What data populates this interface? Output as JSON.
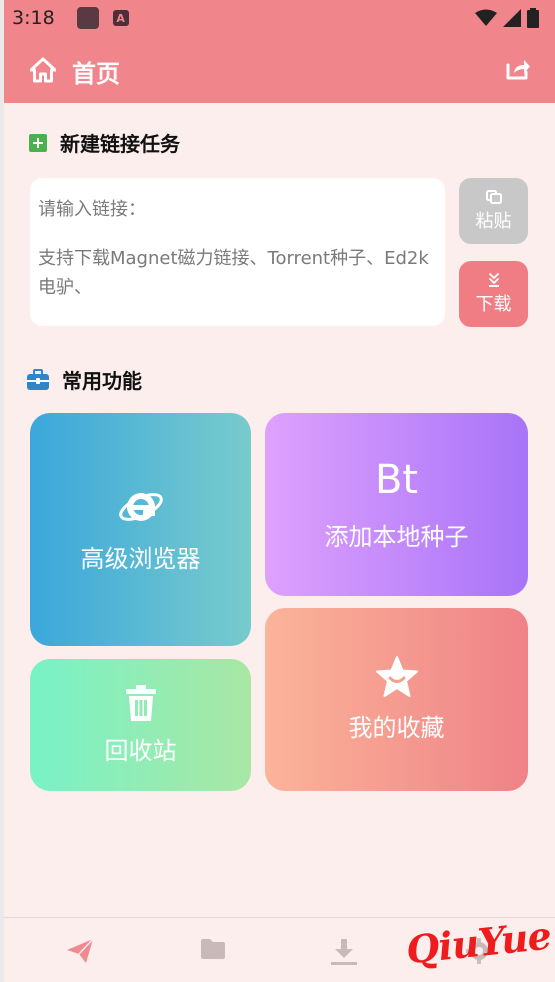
{
  "status_bar": {
    "time": "3:18",
    "app_icon_letter": "A"
  },
  "header": {
    "title": "首页"
  },
  "new_task": {
    "title": "新建链接任务",
    "placeholder": "请输入链接：",
    "hint": "支持下载Magnet磁力链接、Torrent种子、Ed2k电驴、",
    "paste_label": "粘贴",
    "download_label": "下载"
  },
  "features": {
    "title": "常用功能",
    "browser_label": "高级浏览器",
    "bt_logo": "Bt",
    "bt_label": "添加本地种子",
    "trash_label": "回收站",
    "favorites_label": "我的收藏"
  },
  "watermark": "QiuYue",
  "colors": {
    "accent": "#f0858b",
    "background": "#fdeeee",
    "nav_icon": "#c9b9b9"
  },
  "bottom_nav": {
    "items": [
      "send-icon",
      "folder-icon",
      "download-icon",
      "gear-icon"
    ]
  }
}
